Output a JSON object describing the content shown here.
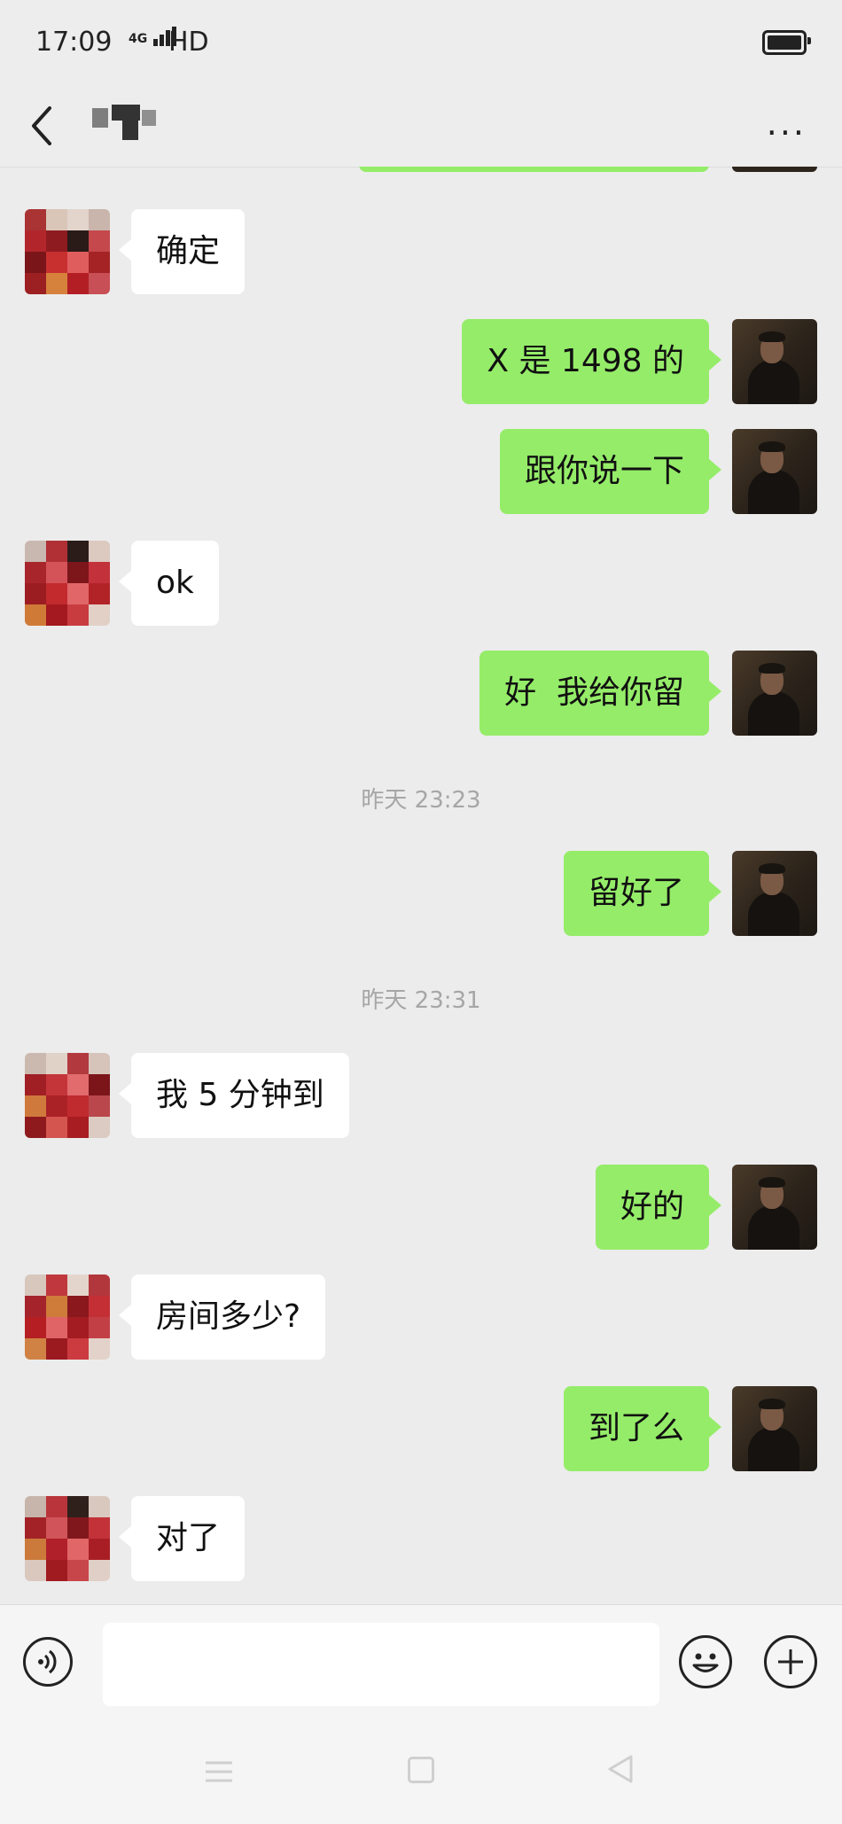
{
  "status_bar": {
    "time": "17:09",
    "network": "4G",
    "hd": "HD"
  },
  "header": {
    "back_icon": "chevron-left-icon",
    "more": "···"
  },
  "messages": [
    {
      "type": "in",
      "text": "确定"
    },
    {
      "type": "out",
      "text": "X 是 1498 的"
    },
    {
      "type": "out",
      "text": "跟你说一下"
    },
    {
      "type": "in",
      "text": "ok"
    },
    {
      "type": "out",
      "text": "好  我给你留"
    },
    {
      "type": "timestamp",
      "text": "昨天 23:23"
    },
    {
      "type": "out",
      "text": "留好了"
    },
    {
      "type": "timestamp",
      "text": "昨天 23:31"
    },
    {
      "type": "in",
      "text": "我 5 分钟到"
    },
    {
      "type": "out",
      "text": "好的"
    },
    {
      "type": "in",
      "text": "房间多少?"
    },
    {
      "type": "out",
      "text": "到了么"
    },
    {
      "type": "in",
      "text": "对了"
    }
  ],
  "input_bar": {
    "voice_icon": "voice-icon",
    "emoji_icon": "emoji-icon",
    "plus_icon": "plus-icon",
    "text_value": ""
  },
  "system_nav": {
    "menu_icon": "menu-icon",
    "home_icon": "home-icon",
    "back_icon": "back-triangle-icon"
  },
  "colors": {
    "outgoing_bubble": "#95ec69",
    "incoming_bubble": "#ffffff",
    "background": "#ececec",
    "timestamp": "#a6a6a6"
  }
}
